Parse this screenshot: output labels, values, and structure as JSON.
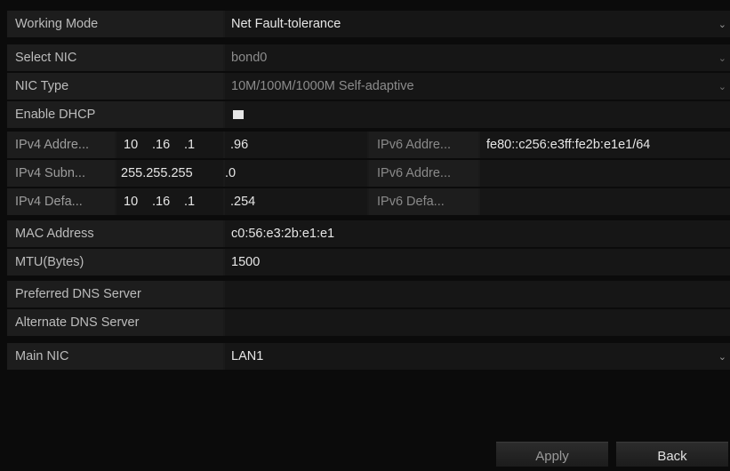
{
  "working_mode": {
    "label": "Working Mode",
    "value": "Net Fault-tolerance"
  },
  "select_nic": {
    "label": "Select NIC",
    "value": "bond0"
  },
  "nic_type": {
    "label": "NIC Type",
    "value": "10M/100M/1000M Self-adaptive"
  },
  "enable_dhcp": {
    "label": "Enable DHCP",
    "checked": false
  },
  "ipv4_address": {
    "label": "IPv4 Addre...",
    "octets": [
      "10",
      ".16",
      ".1",
      ".96"
    ]
  },
  "ipv4_subnet": {
    "label": "IPv4 Subn...",
    "octets": [
      "255",
      ".255",
      ".255",
      ".0"
    ]
  },
  "ipv4_gateway": {
    "label": "IPv4 Defa...",
    "octets": [
      "10",
      ".16",
      ".1",
      ".254"
    ]
  },
  "ipv6_address1": {
    "label": "IPv6 Addre...",
    "value": "fe80::c256:e3ff:fe2b:e1e1/64"
  },
  "ipv6_address2": {
    "label": "IPv6 Addre...",
    "value": ""
  },
  "ipv6_gateway": {
    "label": "IPv6 Defa...",
    "value": ""
  },
  "mac_address": {
    "label": "MAC Address",
    "value": "c0:56:e3:2b:e1:e1"
  },
  "mtu": {
    "label": "MTU(Bytes)",
    "value": "1500"
  },
  "preferred_dns": {
    "label": "Preferred DNS Server",
    "value": ""
  },
  "alternate_dns": {
    "label": "Alternate DNS Server",
    "value": ""
  },
  "main_nic": {
    "label": "Main NIC",
    "value": "LAN1"
  },
  "buttons": {
    "apply": "Apply",
    "back": "Back"
  },
  "icons": {
    "dropdown": "chevron-down-icon"
  },
  "colors": {
    "background": "#0b0b0b",
    "row": "#1d1d1d",
    "text": "#e6e6e6"
  }
}
